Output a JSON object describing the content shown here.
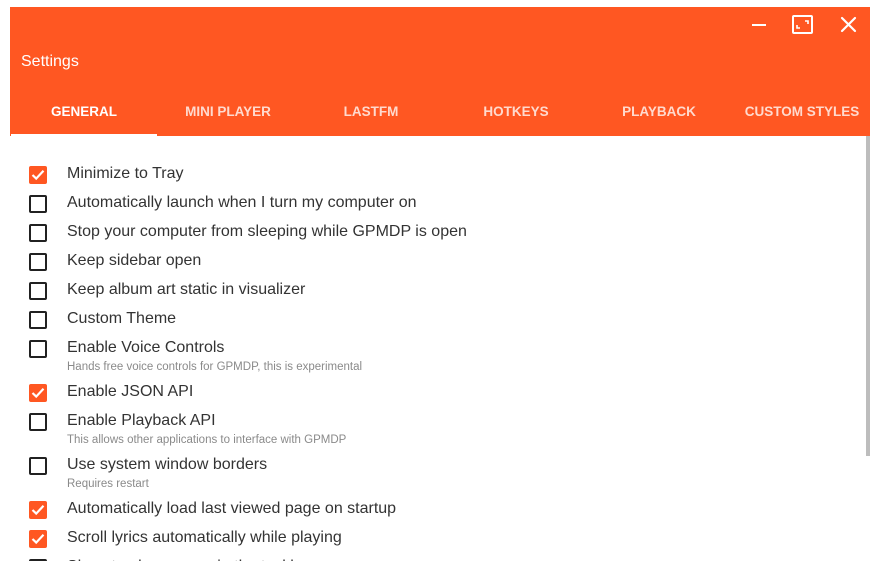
{
  "window": {
    "title": "Settings",
    "controls": [
      "minimize-icon",
      "maximize-icon",
      "close-icon"
    ]
  },
  "colors": {
    "accent": "#ff5722",
    "text": "#333333",
    "subtext": "#8a8a8a"
  },
  "tabs": [
    {
      "label": "GENERAL",
      "active": true
    },
    {
      "label": "MINI PLAYER",
      "active": false
    },
    {
      "label": "LASTFM",
      "active": false
    },
    {
      "label": "HOTKEYS",
      "active": false
    },
    {
      "label": "PLAYBACK",
      "active": false
    },
    {
      "label": "CUSTOM STYLES",
      "active": false
    }
  ],
  "options": [
    {
      "label": "Minimize to Tray",
      "checked": true
    },
    {
      "label": "Automatically launch when I turn my computer on",
      "checked": false
    },
    {
      "label": "Stop your computer from sleeping while GPMDP is open",
      "checked": false
    },
    {
      "label": "Keep sidebar open",
      "checked": false
    },
    {
      "label": "Keep album art static in visualizer",
      "checked": false
    },
    {
      "label": "Custom Theme",
      "checked": false
    },
    {
      "label": "Enable Voice Controls",
      "checked": false,
      "description": "Hands free voice controls for GPMDP, this is experimental"
    },
    {
      "label": "Enable JSON API",
      "checked": true
    },
    {
      "label": "Enable Playback API",
      "checked": false,
      "description": "This allows other applications to interface with GPMDP"
    },
    {
      "label": "Use system window borders",
      "checked": false,
      "description": "Requires restart"
    },
    {
      "label": "Automatically load last viewed page on startup",
      "checked": true
    },
    {
      "label": "Scroll lyrics automatically while playing",
      "checked": true
    },
    {
      "label": "Show track progress in the taskbar",
      "checked": false
    }
  ]
}
